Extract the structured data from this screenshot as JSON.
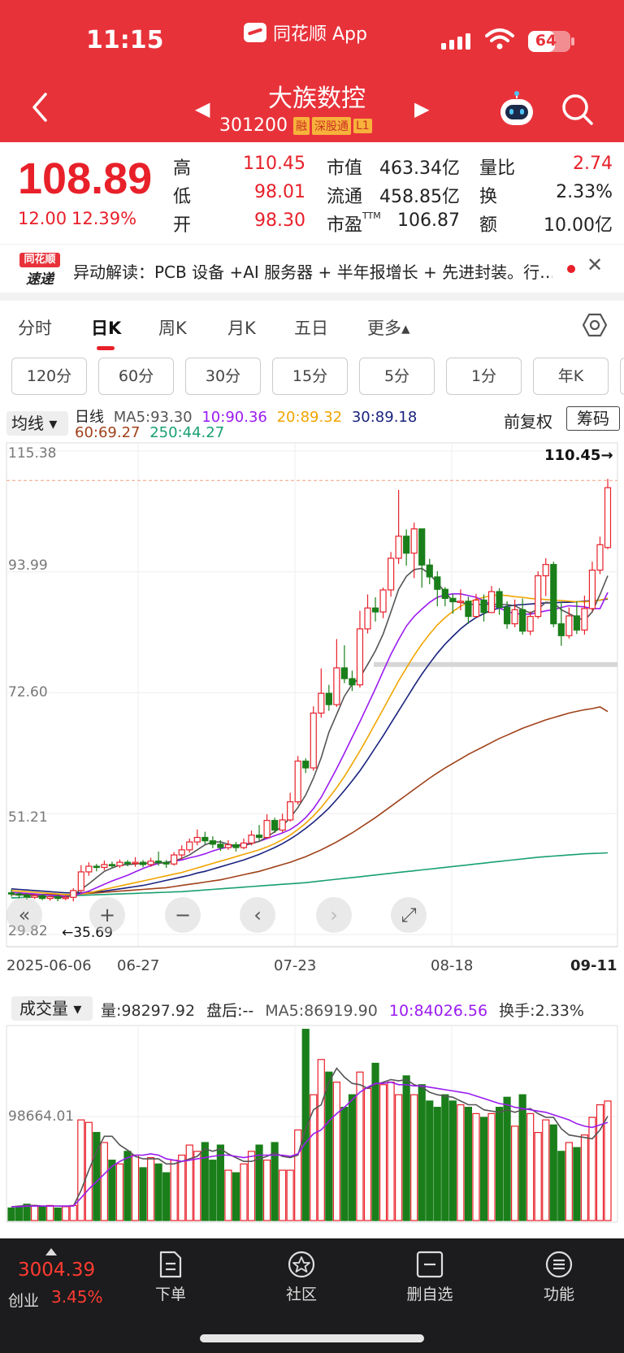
{
  "status": {
    "time": "11:15",
    "app": "同花顺 App",
    "battery": "64",
    "battery_level": 0.64
  },
  "header": {
    "title": "大族数控",
    "code": "301200",
    "tags": [
      "融",
      "深股通",
      "L1"
    ]
  },
  "quote": {
    "price": "108.89",
    "change": "12.00",
    "change_pct": "12.39%",
    "rows": [
      {
        "l1": "高",
        "v1": "110.45",
        "l2": "市值",
        "v2": "463.34亿",
        "l3": "量比",
        "v3": "2.74"
      },
      {
        "l1": "低",
        "v1": "98.01",
        "l2": "流通",
        "v2": "458.85亿",
        "l3": "换",
        "v3": "2.33%"
      },
      {
        "l1": "开",
        "v1": "98.30",
        "l2": "市盈",
        "v2": "106.87",
        "l3": "额",
        "v3": "10.00亿"
      }
    ],
    "ttm": "TTM"
  },
  "news": {
    "logo_top": "同花顺",
    "logo_bottom": "速递",
    "text": "异动解读：PCB 设备 +AI 服务器 + 半年报增长 + 先进封装。行…",
    "close": "✕"
  },
  "tabs": [
    "分时",
    "日K",
    "周K",
    "月K",
    "五日",
    "更多▴"
  ],
  "periods": [
    "120分",
    "60分",
    "30分",
    "15分",
    "5分",
    "1分",
    "年K"
  ],
  "ma_legend": {
    "select": "均线 ▾",
    "day": "日线",
    "ma5": "MA5:93.30",
    "ma10": "10:90.36",
    "ma20": "20:89.32",
    "ma30": "30:89.18",
    "ma60": "60:69.27",
    "ma250": "250:44.27",
    "fuquan": "前复权",
    "chouma": "筹码"
  },
  "colors": {
    "brand": "#e8323a",
    "up": "#e8202a",
    "down": "#1a7f1a",
    "ma5": "#555555",
    "ma10": "#9b1bf0",
    "ma20": "#f0a500",
    "ma30": "#1a237e",
    "ma60": "#a0421a",
    "ma250": "#18a070"
  },
  "kline_labels": {
    "y": [
      "115.38",
      "93.99",
      "72.60",
      "51.21",
      "29.82"
    ],
    "x": [
      "2025-06-06",
      "06-27",
      "07-23",
      "08-18",
      "09-11"
    ],
    "high_mark": "110.45→",
    "low_mark": "←35.69"
  },
  "volume": {
    "select": "成交量 ▾",
    "vol": "量:98297.92",
    "after": "盘后:--",
    "ma5": "MA5:86919.90",
    "ma10": "10:84026.56",
    "turnover": "换手:2.33%",
    "y_label": "98664.01"
  },
  "chart_data": {
    "type": "candlestick",
    "y_range": [
      29.82,
      115.38
    ],
    "x_labels": [
      "2025-06-06",
      "06-27",
      "07-23",
      "08-18",
      "09-11"
    ],
    "candles": [
      [
        37.2,
        37.0,
        37.8,
        36.5
      ],
      [
        37.0,
        36.8,
        37.3,
        36.2
      ],
      [
        36.8,
        36.4,
        37.1,
        36.0
      ],
      [
        36.4,
        36.7,
        37.0,
        36.1
      ],
      [
        36.7,
        36.2,
        37.0,
        35.9
      ],
      [
        36.2,
        36.5,
        36.8,
        35.8
      ],
      [
        36.5,
        36.2,
        36.9,
        35.7
      ],
      [
        36.2,
        36.4,
        36.8,
        35.9
      ],
      [
        36.4,
        37.6,
        38.0,
        35.69
      ],
      [
        37.6,
        40.9,
        42.1,
        37.2
      ],
      [
        40.9,
        41.9,
        42.6,
        40.2
      ],
      [
        41.9,
        41.7,
        42.3,
        41.0
      ],
      [
        41.7,
        42.2,
        42.9,
        41.2
      ],
      [
        42.2,
        42.0,
        42.7,
        41.5
      ],
      [
        42.0,
        42.6,
        43.1,
        41.6
      ],
      [
        42.6,
        42.4,
        43.0,
        41.9
      ],
      [
        42.4,
        42.6,
        43.5,
        41.8
      ],
      [
        42.6,
        42.2,
        43.0,
        41.7
      ],
      [
        42.2,
        42.8,
        43.4,
        41.8
      ],
      [
        42.8,
        42.6,
        44.5,
        42.0
      ],
      [
        42.6,
        42.3,
        43.0,
        41.6
      ],
      [
        42.3,
        43.9,
        44.4,
        42.0
      ],
      [
        43.9,
        44.8,
        45.6,
        43.1
      ],
      [
        44.8,
        46.2,
        46.8,
        44.3
      ],
      [
        46.2,
        47.0,
        48.4,
        45.6
      ],
      [
        47.0,
        46.4,
        48.0,
        45.8
      ],
      [
        46.4,
        45.8,
        47.2,
        45.1
      ],
      [
        45.8,
        45.2,
        46.5,
        44.6
      ],
      [
        45.2,
        45.7,
        46.5,
        44.8
      ],
      [
        45.7,
        45.2,
        46.2,
        44.5
      ],
      [
        45.2,
        46.0,
        46.8,
        44.9
      ],
      [
        46.0,
        47.4,
        48.2,
        45.6
      ],
      [
        47.4,
        47.0,
        49.2,
        46.4
      ],
      [
        47.0,
        50.0,
        51.1,
        46.8
      ],
      [
        50.0,
        48.3,
        50.5,
        47.8
      ],
      [
        48.3,
        50.1,
        51.2,
        47.9
      ],
      [
        50.1,
        53.3,
        54.9,
        49.8
      ],
      [
        53.3,
        60.5,
        61.4,
        52.8
      ],
      [
        60.5,
        59.3,
        61.0,
        58.4
      ],
      [
        59.3,
        69.0,
        70.2,
        58.8
      ],
      [
        69.0,
        72.5,
        76.9,
        68.2
      ],
      [
        72.5,
        70.5,
        74.0,
        69.4
      ],
      [
        70.5,
        77.0,
        82.1,
        70.1
      ],
      [
        77.0,
        75.1,
        81.0,
        74.3
      ],
      [
        75.1,
        74.0,
        76.5,
        72.9
      ],
      [
        74.0,
        83.9,
        87.1,
        73.5
      ],
      [
        83.9,
        87.6,
        90.0,
        83.1
      ],
      [
        87.6,
        86.9,
        89.5,
        85.2
      ],
      [
        86.9,
        90.8,
        91.2,
        85.8
      ],
      [
        90.8,
        96.4,
        97.5,
        89.6
      ],
      [
        96.4,
        100.3,
        108.5,
        95.4
      ],
      [
        100.3,
        97.3,
        101.5,
        95.1
      ],
      [
        97.3,
        101.6,
        102.7,
        92.9
      ],
      [
        101.6,
        95.2,
        96.9,
        91.2
      ],
      [
        95.2,
        93.1,
        96.3,
        91.8
      ],
      [
        93.1,
        90.9,
        94.1,
        87.9
      ],
      [
        90.9,
        89.3,
        91.3,
        87.9
      ],
      [
        89.3,
        88.7,
        90.1,
        86.6
      ],
      [
        88.7,
        88.8,
        90.9,
        87.2
      ],
      [
        88.8,
        86.1,
        89.6,
        84.8
      ],
      [
        86.1,
        89.0,
        90.1,
        85.9
      ],
      [
        89.0,
        86.8,
        90.0,
        85.2
      ],
      [
        86.8,
        90.5,
        91.5,
        86.7
      ],
      [
        90.5,
        87.7,
        91.1,
        86.4
      ],
      [
        87.7,
        84.8,
        88.8,
        83.9
      ],
      [
        84.8,
        87.3,
        89.1,
        84.2
      ],
      [
        87.3,
        83.5,
        89.3,
        82.9
      ],
      [
        83.5,
        86.1,
        87.0,
        82.8
      ],
      [
        86.1,
        93.3,
        94.1,
        85.7
      ],
      [
        93.3,
        95.3,
        96.4,
        89.7
      ],
      [
        95.3,
        84.8,
        95.8,
        84.2
      ],
      [
        84.8,
        82.7,
        88.7,
        80.9
      ],
      [
        82.7,
        86.2,
        87.7,
        82.2
      ],
      [
        86.2,
        83.7,
        88.8,
        83.0
      ],
      [
        83.7,
        87.5,
        89.8,
        82.9
      ],
      [
        87.5,
        94.3,
        95.8,
        87.0
      ],
      [
        94.3,
        98.8,
        100.2,
        93.6
      ],
      [
        98.3,
        108.89,
        110.45,
        98.01
      ]
    ],
    "ma5": [
      37.0,
      36.9,
      36.8,
      36.7,
      36.6,
      36.5,
      36.4,
      36.4,
      36.8,
      37.8,
      38.8,
      39.9,
      41.0,
      41.6,
      42.1,
      42.2,
      42.3,
      42.4,
      42.5,
      42.5,
      42.5,
      42.8,
      43.3,
      43.9,
      44.8,
      45.7,
      46.2,
      46.2,
      45.8,
      45.5,
      45.6,
      45.9,
      46.3,
      47.1,
      48.0,
      49.0,
      50.5,
      52.3,
      54.5,
      57.5,
      61.1,
      65.6,
      68.8,
      72.0,
      74.1,
      75.3,
      77.6,
      80.0,
      83.0,
      86.9,
      90.9,
      93.2,
      94.4,
      94.6,
      93.6,
      92.0,
      90.4,
      88.8,
      88.6,
      88.3,
      88.2,
      88.2,
      88.3,
      88.2,
      88.2,
      88.0,
      87.3,
      86.7,
      87.4,
      88.6,
      88.5,
      87.3,
      86.6,
      85.9,
      85.4,
      86.9,
      90.0,
      93.3
    ],
    "ma10": [
      37.3,
      37.2,
      37.1,
      37.0,
      36.9,
      36.8,
      36.7,
      36.6,
      36.7,
      37.1,
      37.5,
      38.1,
      38.7,
      39.3,
      39.8,
      40.3,
      40.9,
      41.5,
      42.0,
      42.4,
      42.6,
      42.8,
      43.0,
      43.4,
      43.7,
      44.1,
      44.6,
      45.0,
      45.3,
      45.6,
      45.8,
      46.0,
      46.3,
      46.8,
      47.3,
      47.8,
      48.4,
      49.3,
      50.5,
      52.1,
      54.1,
      56.6,
      59.2,
      61.9,
      64.7,
      67.5,
      70.4,
      73.3,
      76.4,
      79.4,
      82.0,
      84.4,
      86.1,
      87.4,
      88.6,
      89.5,
      89.9,
      90.1,
      90.1,
      89.8,
      89.5,
      88.9,
      88.1,
      87.6,
      87.0,
      86.6,
      86.5,
      86.5,
      86.8,
      87.1,
      87.3,
      87.7,
      88.0,
      87.9,
      87.8,
      87.5,
      87.5,
      90.36
    ],
    "ma20": [
      37.6,
      37.5,
      37.4,
      37.3,
      37.2,
      37.1,
      37.0,
      36.9,
      36.9,
      37.0,
      37.2,
      37.5,
      37.8,
      38.1,
      38.4,
      38.7,
      39.0,
      39.3,
      39.6,
      39.9,
      40.2,
      40.5,
      40.8,
      41.2,
      41.6,
      42.0,
      42.4,
      42.8,
      43.2,
      43.6,
      44.0,
      44.4,
      44.8,
      45.3,
      45.9,
      46.6,
      47.4,
      48.4,
      49.5,
      50.8,
      52.3,
      54.0,
      55.8,
      57.8,
      60.0,
      62.3,
      64.7,
      67.2,
      69.7,
      72.2,
      74.7,
      77.0,
      79.2,
      81.2,
      83.0,
      84.6,
      85.9,
      87.0,
      87.9,
      88.6,
      89.1,
      89.5,
      89.8,
      89.9,
      89.8,
      89.6,
      89.5,
      89.3,
      89.2,
      89.1,
      89.0,
      88.9,
      88.8,
      88.7,
      88.7,
      88.8,
      89.0,
      89.32
    ],
    "ma30": [
      37.9,
      37.8,
      37.7,
      37.6,
      37.5,
      37.4,
      37.3,
      37.2,
      37.2,
      37.2,
      37.3,
      37.4,
      37.5,
      37.7,
      37.9,
      38.1,
      38.3,
      38.5,
      38.8,
      39.1,
      39.4,
      39.7,
      40.0,
      40.3,
      40.7,
      41.0,
      41.4,
      41.8,
      42.2,
      42.6,
      43.0,
      43.5,
      44.0,
      44.6,
      45.2,
      45.9,
      46.7,
      47.6,
      48.6,
      49.7,
      50.9,
      52.2,
      53.7,
      55.3,
      57.0,
      58.8,
      60.8,
      62.9,
      65.0,
      67.2,
      69.4,
      71.6,
      73.8,
      75.9,
      77.8,
      79.6,
      81.2,
      82.6,
      83.9,
      85.0,
      85.9,
      86.6,
      87.2,
      87.6,
      87.9,
      88.1,
      88.2,
      88.3,
      88.4,
      88.5,
      88.5,
      88.6,
      88.6,
      88.7,
      88.8,
      88.9,
      89.0,
      89.18
    ],
    "ma60": [
      36.9,
      36.9,
      36.9,
      36.9,
      36.9,
      36.9,
      36.9,
      36.9,
      36.9,
      37.0,
      37.1,
      37.2,
      37.3,
      37.4,
      37.5,
      37.6,
      37.7,
      37.8,
      37.9,
      38.0,
      38.1,
      38.3,
      38.5,
      38.7,
      38.9,
      39.1,
      39.3,
      39.5,
      39.8,
      40.1,
      40.4,
      40.7,
      41.0,
      41.4,
      41.8,
      42.2,
      42.6,
      43.1,
      43.6,
      44.2,
      44.8,
      45.5,
      46.2,
      47.0,
      47.8,
      48.7,
      49.6,
      50.5,
      51.5,
      52.5,
      53.5,
      54.5,
      55.5,
      56.5,
      57.5,
      58.4,
      59.3,
      60.1,
      60.9,
      61.7,
      62.4,
      63.1,
      63.8,
      64.5,
      65.1,
      65.7,
      66.3,
      66.8,
      67.3,
      67.8,
      68.2,
      68.6,
      69.0,
      69.3,
      69.6,
      69.8,
      70.1,
      69.27
    ],
    "ma250": [
      36.3,
      36.35,
      36.4,
      36.45,
      36.5,
      36.55,
      36.6,
      36.65,
      36.7,
      36.75,
      36.8,
      36.85,
      36.9,
      36.95,
      37.0,
      37.05,
      37.1,
      37.15,
      37.2,
      37.25,
      37.3,
      37.35,
      37.4,
      37.5,
      37.6,
      37.7,
      37.8,
      37.9,
      38.0,
      38.1,
      38.2,
      38.3,
      38.4,
      38.5,
      38.6,
      38.7,
      38.8,
      38.9,
      39.0,
      39.15,
      39.3,
      39.45,
      39.6,
      39.75,
      39.9,
      40.05,
      40.2,
      40.35,
      40.5,
      40.65,
      40.8,
      40.95,
      41.1,
      41.25,
      41.4,
      41.55,
      41.7,
      41.85,
      42.0,
      42.15,
      42.3,
      42.45,
      42.6,
      42.75,
      42.9,
      43.05,
      43.2,
      43.35,
      43.5,
      43.6,
      43.7,
      43.8,
      43.9,
      44.0,
      44.1,
      44.15,
      44.2,
      44.27
    ],
    "volumes": [
      10,
      11,
      13,
      12,
      11,
      12,
      10,
      11,
      12,
      80,
      78,
      70,
      62,
      48,
      45,
      55,
      52,
      42,
      50,
      45,
      38,
      48,
      52,
      60,
      55,
      62,
      48,
      60,
      40,
      38,
      45,
      55,
      60,
      48,
      62,
      40,
      40,
      72,
      152,
      100,
      128,
      118,
      110,
      90,
      100,
      118,
      105,
      125,
      108,
      110,
      100,
      115,
      100,
      108,
      95,
      90,
      100,
      95,
      92,
      90,
      85,
      82,
      85,
      90,
      98,
      75,
      100,
      85,
      70,
      80,
      76,
      55,
      62,
      58,
      68,
      82,
      92,
      95
    ],
    "vol_ma5": [
      11,
      11.5,
      12,
      12,
      11.5,
      11.5,
      11.5,
      11.5,
      11.5,
      24,
      40,
      55,
      67,
      67,
      60,
      56,
      51,
      49,
      49,
      49,
      45,
      45,
      47,
      49,
      51,
      57,
      55,
      57,
      53,
      50,
      47,
      47,
      49,
      51,
      54,
      51,
      50,
      52,
      73,
      88,
      92,
      110,
      121,
      114,
      109,
      108,
      105,
      108,
      110,
      112,
      111,
      112,
      108,
      106,
      102,
      100,
      99,
      98,
      95,
      92,
      92,
      88,
      87,
      86,
      88,
      86,
      88,
      89,
      85,
      82,
      82,
      73,
      68,
      67,
      66,
      65,
      72,
      83
    ],
    "vol_ma10": [
      11,
      11,
      11.5,
      11.5,
      11.5,
      11.5,
      11.5,
      11.5,
      11.5,
      18,
      25,
      31,
      37,
      43,
      47,
      50,
      52,
      52,
      53,
      52,
      49,
      48,
      47,
      48,
      49,
      50,
      51,
      52,
      52,
      51,
      50,
      51,
      52,
      52,
      52,
      52,
      51,
      53,
      62,
      69,
      72,
      79,
      85,
      90,
      96,
      102,
      106,
      109,
      109,
      110,
      108,
      108,
      107,
      107,
      106,
      105,
      104,
      103,
      102,
      101,
      99,
      97,
      95,
      93,
      92,
      90,
      89,
      88,
      87,
      86,
      84,
      82,
      80,
      77,
      75,
      74,
      76,
      78
    ]
  },
  "bottom": {
    "index_value": "3004.39",
    "index_name": "创业",
    "index_pct": "3.45%",
    "nav": [
      "下单",
      "社区",
      "删自选",
      "功能"
    ]
  }
}
